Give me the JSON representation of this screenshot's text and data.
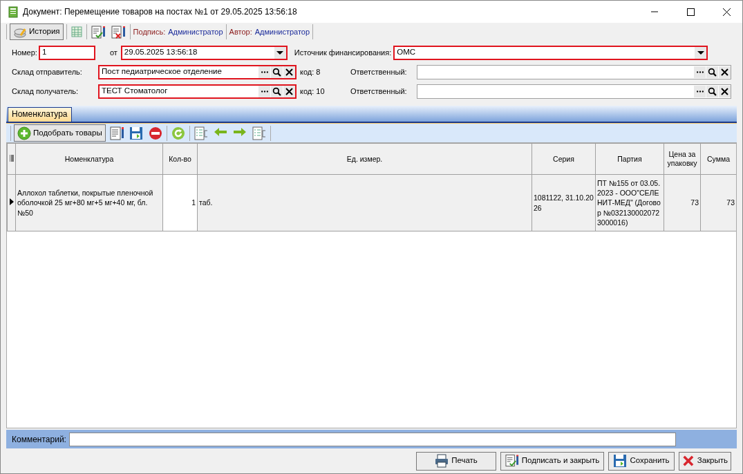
{
  "window": {
    "title": "Документ: Перемещение товаров на постах №1 от 29.05.2025 13:56:18"
  },
  "toolbar": {
    "history_button": "История",
    "signature_label": "Подпись:",
    "signature_value": "Администратор",
    "author_label": "Автор:",
    "author_value": "Администратор"
  },
  "form": {
    "number": {
      "label": "Номер:",
      "value": "1",
      "required": true
    },
    "date": {
      "label": "от",
      "value": "29.05.2025 13:56:18",
      "required": true
    },
    "financing": {
      "label": "Источник финансирования:",
      "value": "ОМС",
      "required": true
    },
    "sender": {
      "label": "Склад отправитель:",
      "value": "Пост педиатрическое отделение",
      "code": "код: 8",
      "required": true
    },
    "sender_responsible": {
      "label": "Ответственный:",
      "required": false
    },
    "receiver": {
      "label": "Склад получатель:",
      "value": "ТЕСТ Стоматолог",
      "code": "код: 10",
      "required": true
    },
    "receiver_responsible": {
      "label": "Ответственный:",
      "required": false
    }
  },
  "tabs": [
    {
      "label": "Номенклатура",
      "selected": true
    }
  ],
  "grid_toolbar": {
    "pick_button": "Подобрать товары"
  },
  "table": {
    "columns": [
      "Номенклатура",
      "Кол-во",
      "Ед. измер.",
      "Серия",
      "Партия",
      "Цена за упаковку",
      "Сумма"
    ],
    "rows": [
      {
        "selected": true,
        "cells": [
          "Аллохол таблетки, покрытые пленочной оболочкой 25 мг+80 мг+5 мг+40 мг, бл. №50",
          "1",
          "таб.",
          "1081122, 31.10.2026",
          "ПТ №155 от 03.05.2023 - ООО\"СЕЛЕНИТ-МЕД\" (Договор №0321300020723000016)",
          "73",
          "73"
        ]
      }
    ]
  },
  "comment": {
    "label": "Комментарий:"
  },
  "buttons": [
    {
      "kind": "print",
      "label": "Печать"
    },
    {
      "kind": "sign",
      "label": "Подписать и закрыть"
    },
    {
      "kind": "save",
      "label": "Сохранить"
    },
    {
      "kind": "close",
      "label": "Закрыть"
    }
  ]
}
